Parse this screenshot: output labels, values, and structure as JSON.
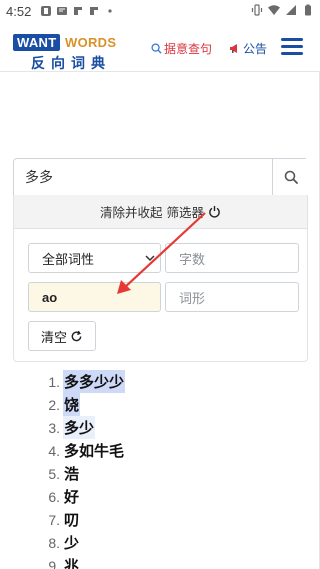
{
  "status_bar": {
    "time": "4:52",
    "left_icons": [
      "notification-icon",
      "message-icon",
      "app-icon",
      "app-icon",
      "dot-icon"
    ],
    "right_icons": [
      "vibrate-icon",
      "wifi-icon",
      "signal-icon",
      "battery-icon"
    ]
  },
  "header": {
    "logo_want": "WANT",
    "logo_words": "WORDS",
    "logo_cn": "反向词典",
    "fuzzy_label": "据意查句",
    "notice_label": "公告",
    "menu_icon": "hamburger-icon"
  },
  "search": {
    "value": "多多",
    "icon": "search-icon"
  },
  "filter": {
    "clear_collapse_label": "清除并收起 筛选器",
    "power_icon": "power-icon",
    "pos_selected": "全部词性",
    "wordcount_placeholder": "字数",
    "pinyin_value": "ao",
    "wordform_placeholder": "词形",
    "clear_label": "清空",
    "refresh_icon": "refresh-icon"
  },
  "annotation_color": "#e53935",
  "results": [
    {
      "num": "1.",
      "word": "多多少少"
    },
    {
      "num": "2.",
      "word": "饶"
    },
    {
      "num": "3.",
      "word": "多少"
    },
    {
      "num": "4.",
      "word": "多如牛毛"
    },
    {
      "num": "5.",
      "word": "浩"
    },
    {
      "num": "6.",
      "word": "好"
    },
    {
      "num": "7.",
      "word": "叨"
    },
    {
      "num": "8.",
      "word": "少"
    },
    {
      "num": "9.",
      "word": "兆"
    }
  ]
}
